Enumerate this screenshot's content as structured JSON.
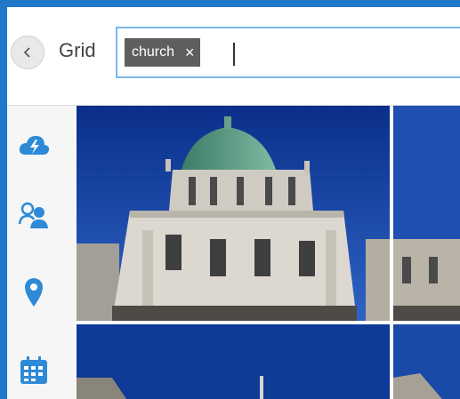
{
  "header": {
    "title": "Grid",
    "search": {
      "chip_label": "church",
      "chip_remove": "×",
      "value": ""
    }
  },
  "sidebar": {
    "items": [
      {
        "name": "cloud-icon"
      },
      {
        "name": "people-icon"
      },
      {
        "name": "location-pin-icon"
      },
      {
        "name": "calendar-icon"
      }
    ]
  },
  "colors": {
    "accent": "#1f78c8",
    "icon_blue": "#2d8ad6",
    "chip_bg": "#5e5e5e",
    "search_border": "#79b7e8"
  },
  "grid": {
    "tiles": [
      {
        "subject": "church-dome-photo"
      },
      {
        "subject": "church-photo-partial"
      },
      {
        "subject": "church-photo-partial"
      },
      {
        "subject": "church-photo-partial"
      }
    ]
  }
}
